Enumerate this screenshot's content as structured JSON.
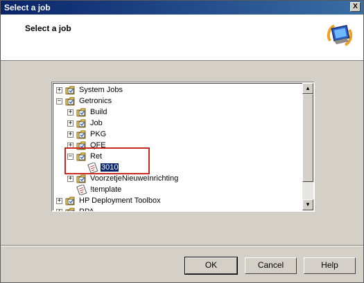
{
  "window": {
    "title": "Select a job",
    "close_glyph": "X"
  },
  "header": {
    "title": "Select a job",
    "icon": "computer-arrows-icon"
  },
  "tree": {
    "nodes": [
      {
        "label": "System Jobs",
        "expander": "+",
        "icon": "job-folder-icon"
      },
      {
        "label": "Getronics",
        "expander": "−",
        "icon": "job-folder-icon"
      },
      {
        "label": "Build",
        "expander": "+",
        "icon": "job-folder-icon"
      },
      {
        "label": "Job",
        "expander": "+",
        "icon": "job-folder-icon"
      },
      {
        "label": "PKG",
        "expander": "+",
        "icon": "job-folder-icon"
      },
      {
        "label": "QFE",
        "expander": "+",
        "icon": "job-folder-icon"
      },
      {
        "label": "Ret",
        "expander": "−",
        "icon": "job-folder-icon"
      },
      {
        "label": "3010",
        "expander": "",
        "icon": "job-item-icon",
        "selected": true
      },
      {
        "label": "VoorzetjeNieuweInrichting",
        "expander": "+",
        "icon": "job-folder-icon"
      },
      {
        "label": "!template",
        "expander": "",
        "icon": "job-item-icon"
      },
      {
        "label": "HP Deployment Toolbox",
        "expander": "+",
        "icon": "job-folder-icon"
      },
      {
        "label": "RPA",
        "expander": "+",
        "icon": "job-folder-icon"
      }
    ]
  },
  "buttons": {
    "ok": "OK",
    "cancel": "Cancel",
    "help": "Help"
  },
  "colors": {
    "highlight_box": "#c8281e",
    "selection": "#0a246a",
    "titlebar": "#0a246a"
  }
}
